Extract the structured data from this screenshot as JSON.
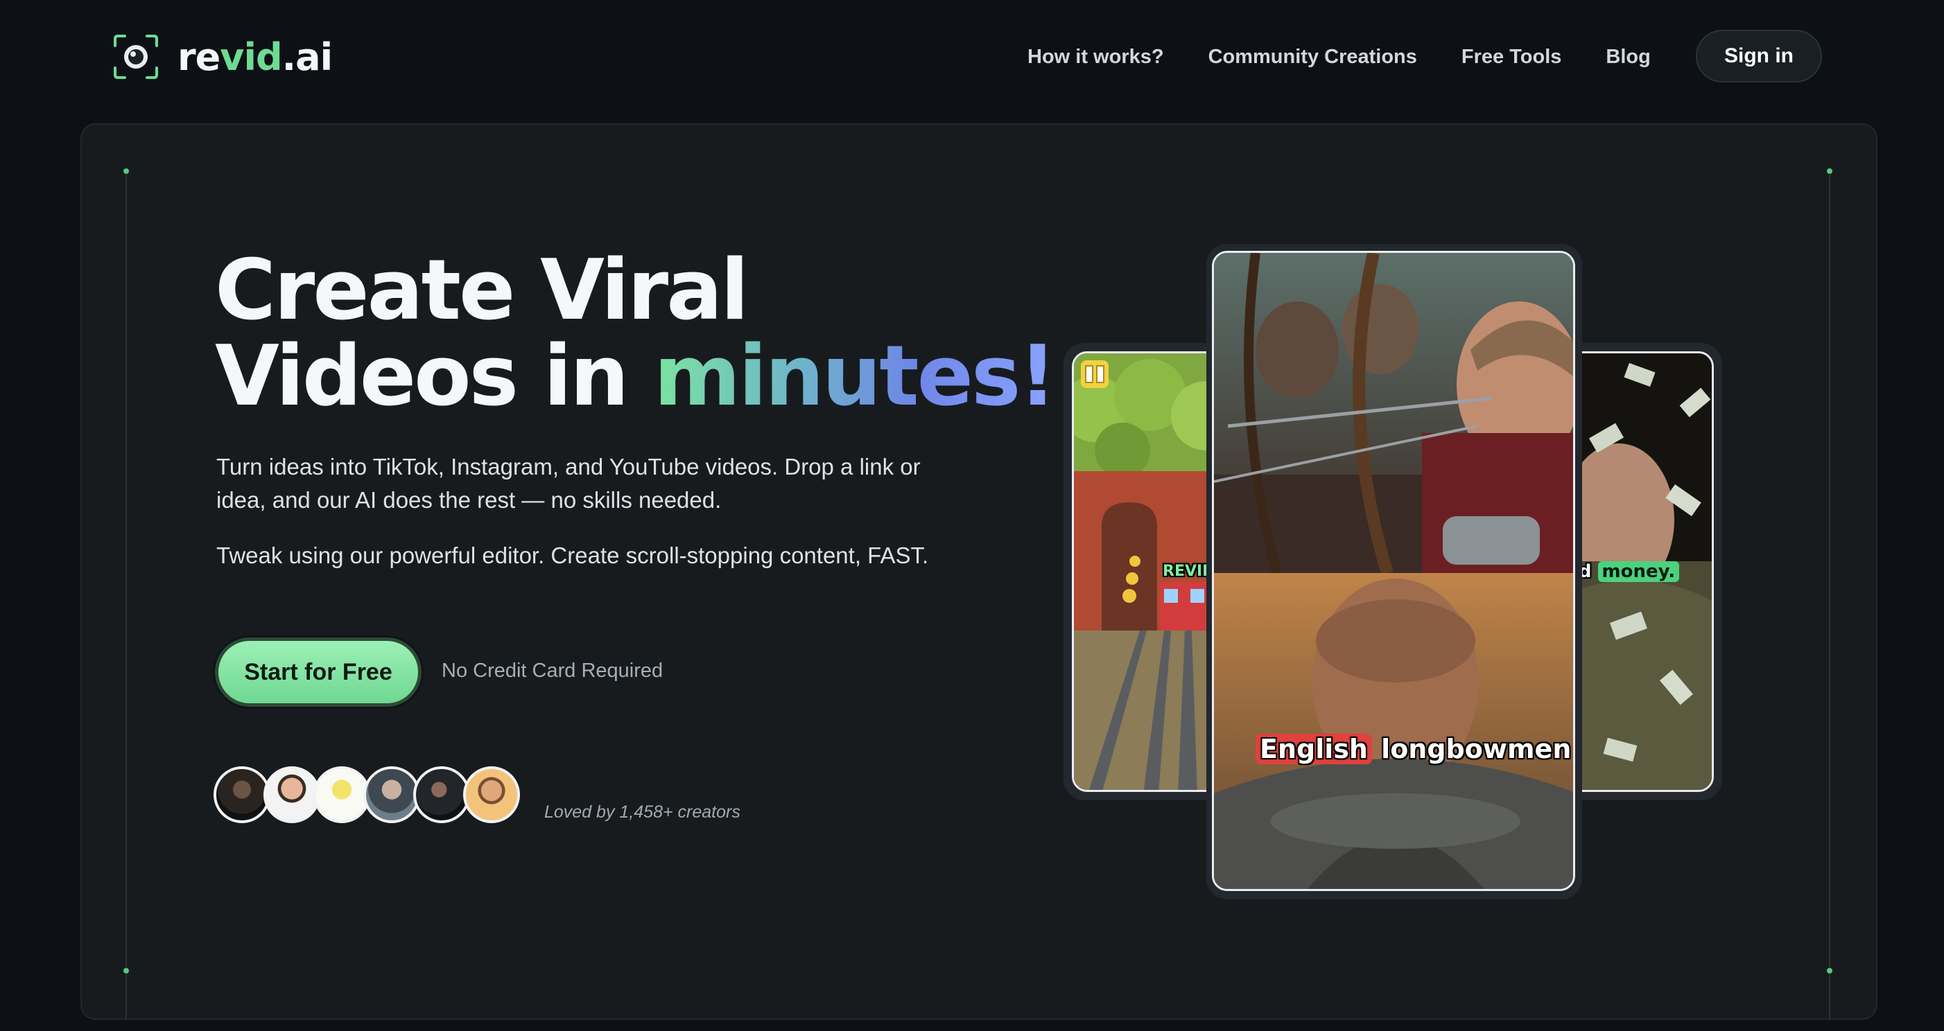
{
  "brand": {
    "name_part1": "re",
    "name_accent": "vid",
    "name_part2": ".ai",
    "accent_color": "#6fdb92"
  },
  "nav": {
    "links": [
      "How it works?",
      "Community Creations",
      "Free Tools",
      "Blog"
    ],
    "signin_label": "Sign in"
  },
  "hero": {
    "title_line1": "Create Viral",
    "title_line2_plain": "Videos in ",
    "title_line2_gradient": "minutes!",
    "paragraph1": "Turn ideas into TikTok, Instagram, and YouTube videos. Drop a link or idea, and our AI does the rest — no skills needed.",
    "paragraph2": "Tweak using our powerful editor. Create scroll-stopping content, FAST.",
    "cta_label": "Start for Free",
    "cta_note": "No Credit Card Required",
    "social_proof": "Loved by 1,458+ creators"
  },
  "videos": {
    "left_watermark": "REVID.",
    "center_caption_highlight": "English",
    "center_caption_rest": " longbowmen",
    "right_caption_partial": "od",
    "right_caption_highlight": "money."
  },
  "colors": {
    "background": "#0d1116",
    "panel": "#171b1e",
    "cta": "#7ee3a0",
    "caption_highlight": "#e0423d"
  }
}
